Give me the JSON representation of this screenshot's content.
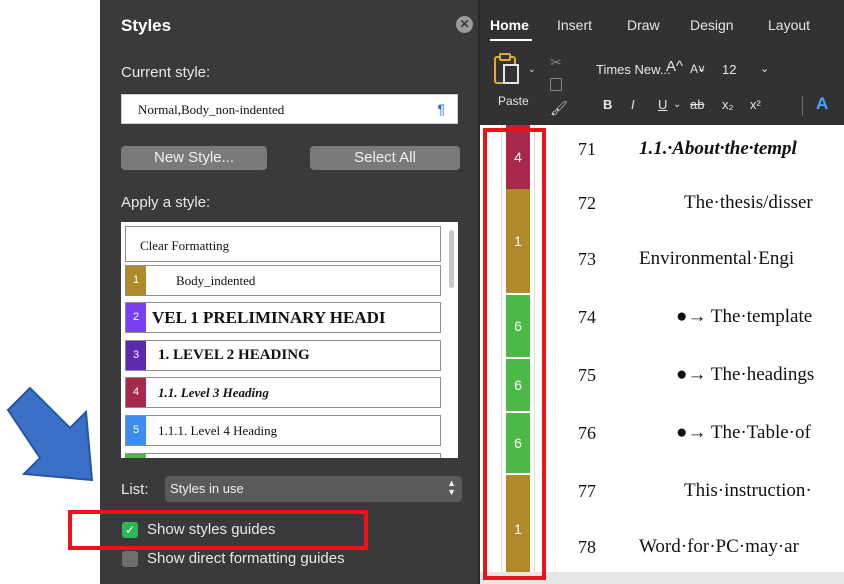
{
  "styles_panel": {
    "title": "Styles",
    "close_glyph": "✕",
    "current_style_label": "Current style:",
    "current_style_value": "Normal,Body_non-indented",
    "pilcrow": "¶",
    "new_style_label": "New Style...",
    "select_all_label": "Select All",
    "apply_label": "Apply a style:",
    "styles": [
      {
        "label": "Clear Formatting",
        "badge": "",
        "color": ""
      },
      {
        "label": "Body_indented",
        "badge": "1",
        "color": "#b0892a"
      },
      {
        "label": "VEL 1 PRELIMINARY HEADI",
        "badge": "2",
        "color": "#7a3ff0"
      },
      {
        "label": "1. LEVEL 2 HEADING",
        "badge": "3",
        "color": "#5c2ab0"
      },
      {
        "label": "1.1. Level 3 Heading",
        "badge": "4",
        "color": "#a8294a"
      },
      {
        "label": "1.1.1.  Level 4 Heading",
        "badge": "5",
        "color": "#3c8df0"
      }
    ],
    "list_label": "List:",
    "list_value": "Styles in use",
    "show_styles_guides": "Show styles guides",
    "show_direct_formatting_guides": "Show direct formatting guides",
    "check_glyph": "✓"
  },
  "ribbon": {
    "tabs": [
      "Home",
      "Insert",
      "Draw",
      "Design",
      "Layout"
    ],
    "paste_label": "Paste",
    "font_name": "Times New...",
    "font_size": "12",
    "caret": "⌄",
    "grow_font": "A^",
    "shrink_font": "A˅",
    "bold": "B",
    "italic": "I",
    "underline": "U",
    "strikethrough": "ab",
    "subscript": "x₂",
    "superscript": "x²",
    "text_effects": "A"
  },
  "document": {
    "guides": [
      {
        "value": "4",
        "color": "#a8294a"
      },
      {
        "value": "1",
        "color": "#b0892a"
      },
      {
        "value": "6",
        "color": "#4cb848"
      },
      {
        "value": "6",
        "color": "#4cb848"
      },
      {
        "value": "6",
        "color": "#4cb848"
      },
      {
        "value": "1",
        "color": "#b0892a"
      }
    ],
    "lines": [
      {
        "no": "71",
        "text": "1.1.·About·the·templ"
      },
      {
        "no": "72",
        "text": "The·thesis/disser"
      },
      {
        "no": "73",
        "text": "Environmental·Engi"
      },
      {
        "no": "74",
        "text": "●→ The·template"
      },
      {
        "no": "75",
        "text": "●→ The·headings"
      },
      {
        "no": "76",
        "text": "●→ The·Table·of"
      },
      {
        "no": "77",
        "text": "This·instruction·"
      },
      {
        "no": "78",
        "text": "Word·for·PC·may·ar"
      }
    ]
  }
}
